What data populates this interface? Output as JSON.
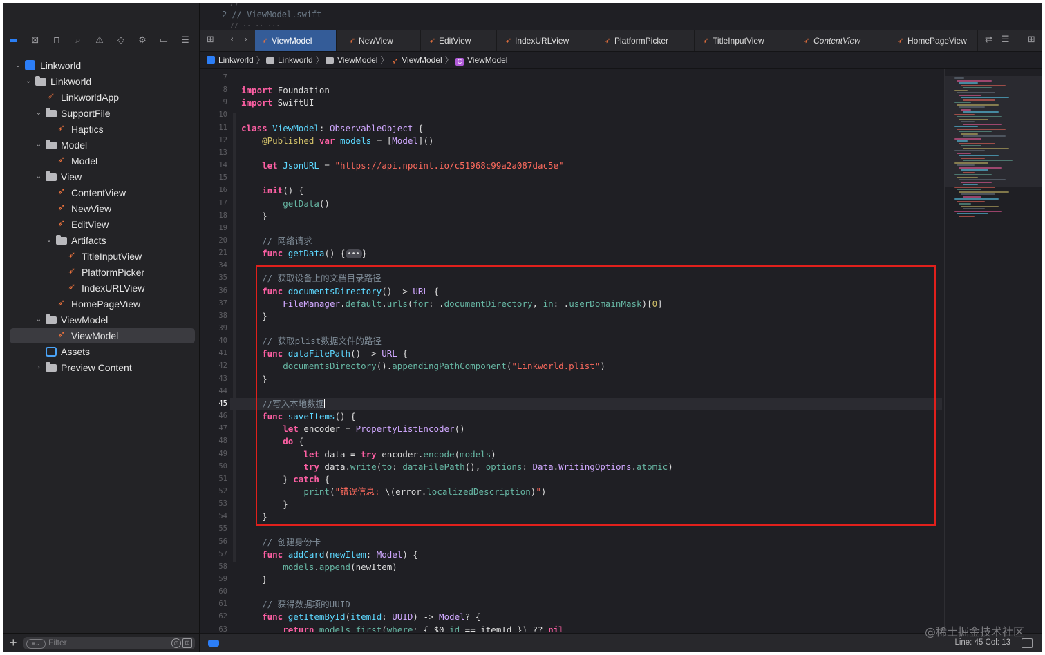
{
  "peek": {
    "line2": "2  //  ViewModel.swift"
  },
  "sidebar": {
    "tools": [
      {
        "name": "project-navigator-icon",
        "glyph": "▬"
      },
      {
        "name": "source-control-icon",
        "glyph": "⊠"
      },
      {
        "name": "symbol-navigator-icon",
        "glyph": "⊓"
      },
      {
        "name": "search-icon",
        "glyph": "⌕"
      },
      {
        "name": "issue-icon",
        "glyph": "⚠"
      },
      {
        "name": "test-icon",
        "glyph": "◇"
      },
      {
        "name": "debug-icon",
        "glyph": "⚙"
      },
      {
        "name": "breakpoint-icon",
        "glyph": "▭"
      },
      {
        "name": "report-icon",
        "glyph": "☰"
      }
    ],
    "tree": [
      {
        "label": "Linkworld",
        "icon": "proj",
        "chev": "down",
        "depth": 0
      },
      {
        "label": "Linkworld",
        "icon": "folder",
        "chev": "down",
        "depth": 1
      },
      {
        "label": "LinkworldApp",
        "icon": "swift",
        "chev": "",
        "depth": 2
      },
      {
        "label": "SupportFile",
        "icon": "folder",
        "chev": "down",
        "depth": 2
      },
      {
        "label": "Haptics",
        "icon": "swift",
        "chev": "",
        "depth": 3
      },
      {
        "label": "Model",
        "icon": "folder",
        "chev": "down",
        "depth": 2
      },
      {
        "label": "Model",
        "icon": "swift",
        "chev": "",
        "depth": 3
      },
      {
        "label": "View",
        "icon": "folder",
        "chev": "down",
        "depth": 2
      },
      {
        "label": "ContentView",
        "icon": "swift",
        "chev": "",
        "depth": 3
      },
      {
        "label": "NewView",
        "icon": "swift",
        "chev": "",
        "depth": 3
      },
      {
        "label": "EditView",
        "icon": "swift",
        "chev": "",
        "depth": 3
      },
      {
        "label": "Artifacts",
        "icon": "folder",
        "chev": "down",
        "depth": 3
      },
      {
        "label": "TitleInputView",
        "icon": "swift",
        "chev": "",
        "depth": 4
      },
      {
        "label": "PlatformPicker",
        "icon": "swift",
        "chev": "",
        "depth": 4
      },
      {
        "label": "IndexURLView",
        "icon": "swift",
        "chev": "",
        "depth": 4
      },
      {
        "label": "HomePageView",
        "icon": "swift",
        "chev": "",
        "depth": 3
      },
      {
        "label": "ViewModel",
        "icon": "folder",
        "chev": "down",
        "depth": 2
      },
      {
        "label": "ViewModel",
        "icon": "swift",
        "chev": "",
        "depth": 3,
        "selected": true
      },
      {
        "label": "Assets",
        "icon": "assets",
        "chev": "",
        "depth": 2
      },
      {
        "label": "Preview Content",
        "icon": "folder",
        "chev": "right",
        "depth": 2
      }
    ],
    "filter_placeholder": "Filter"
  },
  "tabs": [
    {
      "label": "ViewModel",
      "active": true
    },
    {
      "label": "NewView"
    },
    {
      "label": "EditView"
    },
    {
      "label": "IndexURLView"
    },
    {
      "label": "PlatformPicker"
    },
    {
      "label": "TitleInputView"
    },
    {
      "label": "ContentView",
      "italic": true
    },
    {
      "label": "HomePageView"
    }
  ],
  "breadcrumb": [
    {
      "label": "Linkworld",
      "icon": "proj"
    },
    {
      "label": "Linkworld",
      "icon": "folder"
    },
    {
      "label": "ViewModel",
      "icon": "folder"
    },
    {
      "label": "ViewModel",
      "icon": "swift"
    },
    {
      "label": "ViewModel",
      "icon": "cls"
    }
  ],
  "code": [
    {
      "n": "7",
      "h": ""
    },
    {
      "n": "8",
      "h": "<span class='k'>import</span> Foundation"
    },
    {
      "n": "9",
      "h": "<span class='k'>import</span> SwiftUI"
    },
    {
      "n": "10",
      "h": ""
    },
    {
      "n": "11",
      "h": "<span class='k'>class</span> <span class='ty'>ViewModel</span>: <span class='tyo'>ObservableObject</span> {"
    },
    {
      "n": "12",
      "h": "    <span class='t'>@Published</span> <span class='k'>var</span> <span class='ty'>models</span> = [<span class='tyo'>Model</span>]()"
    },
    {
      "n": "13",
      "h": ""
    },
    {
      "n": "14",
      "h": "    <span class='k'>let</span> <span class='ty'>JsonURL</span> = <span class='s'>\"https://api.npoint.io/c51968c99a2a087dac5e\"</span>"
    },
    {
      "n": "15",
      "h": ""
    },
    {
      "n": "16",
      "h": "    <span class='k'>init</span>() {"
    },
    {
      "n": "17",
      "h": "        <span class='fn'>getData</span>()"
    },
    {
      "n": "18",
      "h": "    }"
    },
    {
      "n": "19",
      "h": ""
    },
    {
      "n": "20",
      "h": "    <span class='c'>// 网络请求</span>"
    },
    {
      "n": "21",
      "h": "    <span class='k'>func</span> <span class='ty'>getData</span>() {<span class='pill'>•••</span>}"
    },
    {
      "n": "34",
      "h": ""
    },
    {
      "n": "35",
      "h": "    <span class='c'>// 获取设备上的文档目录路径</span>"
    },
    {
      "n": "36",
      "h": "    <span class='k'>func</span> <span class='ty'>documentsDirectory</span>() -> <span class='tyo'>URL</span> {"
    },
    {
      "n": "37",
      "h": "        <span class='tyo'>FileManager</span>.<span class='fn'>default</span>.<span class='fn'>urls</span>(<span class='fn'>for</span>: .<span class='fn'>documentDirectory</span>, <span class='fn'>in</span>: .<span class='fn'>userDomainMask</span>)[<span class='n'>0</span>]"
    },
    {
      "n": "38",
      "h": "    }"
    },
    {
      "n": "39",
      "h": ""
    },
    {
      "n": "40",
      "h": "    <span class='c'>// 获取plist数据文件的路径</span>"
    },
    {
      "n": "41",
      "h": "    <span class='k'>func</span> <span class='ty'>dataFilePath</span>() -> <span class='tyo'>URL</span> {"
    },
    {
      "n": "42",
      "h": "        <span class='fn'>documentsDirectory</span>().<span class='fn'>appendingPathComponent</span>(<span class='s'>\"Linkworld.plist\"</span>)"
    },
    {
      "n": "43",
      "h": "    }"
    },
    {
      "n": "44",
      "h": ""
    },
    {
      "n": "45",
      "h": "    <span class='c'>//写入本地数据</span><span class='caret'></span>",
      "cur": true
    },
    {
      "n": "46",
      "h": "    <span class='k'>func</span> <span class='ty'>saveItems</span>() {"
    },
    {
      "n": "47",
      "h": "        <span class='k'>let</span> encoder = <span class='tyo'>PropertyListEncoder</span>()"
    },
    {
      "n": "48",
      "h": "        <span class='k'>do</span> {"
    },
    {
      "n": "49",
      "h": "            <span class='k'>let</span> data = <span class='k'>try</span> encoder.<span class='fn'>encode</span>(<span class='fn'>models</span>)"
    },
    {
      "n": "50",
      "h": "            <span class='k'>try</span> data.<span class='fn'>write</span>(<span class='fn'>to</span>: <span class='fn'>dataFilePath</span>(), <span class='fn'>options</span>: <span class='tyo'>Data</span>.<span class='tyo'>WritingOptions</span>.<span class='fn'>atomic</span>)"
    },
    {
      "n": "51",
      "h": "        } <span class='k'>catch</span> {"
    },
    {
      "n": "52",
      "h": "            <span class='fn'>print</span>(<span class='s'>\"错误信息: </span>\\(error.<span class='fn'>localizedDescription</span>)<span class='s'>\"</span>)"
    },
    {
      "n": "53",
      "h": "        }"
    },
    {
      "n": "54",
      "h": "    }"
    },
    {
      "n": "55",
      "h": ""
    },
    {
      "n": "56",
      "h": "    <span class='c'>// 创建身份卡</span>"
    },
    {
      "n": "57",
      "h": "    <span class='k'>func</span> <span class='ty'>addCard</span>(<span class='ty'>newItem</span>: <span class='tyo'>Model</span>) {"
    },
    {
      "n": "58",
      "h": "        <span class='fn'>models</span>.<span class='fn'>append</span>(newItem)"
    },
    {
      "n": "59",
      "h": "    }"
    },
    {
      "n": "60",
      "h": ""
    },
    {
      "n": "61",
      "h": "    <span class='c'>// 获得数据项的UUID</span>"
    },
    {
      "n": "62",
      "h": "    <span class='k'>func</span> <span class='ty'>getItemById</span>(<span class='ty'>itemId</span>: <span class='tyo'>UUID</span>) -> <span class='tyo'>Model</span>? {"
    },
    {
      "n": "63",
      "h": "        <span class='k'>return</span> <span class='fn'>models</span>.<span class='fn'>first</span>(<span class='fn'>where</span>: { $0.<span class='fn'>id</span> == itemId }) ?? <span class='k'>nil</span>"
    }
  ],
  "status": {
    "position": "Line: 45  Col: 13"
  },
  "watermark": "@稀土掘金技术社区",
  "colors": {
    "accent": "#2c7ef7",
    "highlight_box": "#e0201c",
    "tab_active": "#345c98"
  }
}
